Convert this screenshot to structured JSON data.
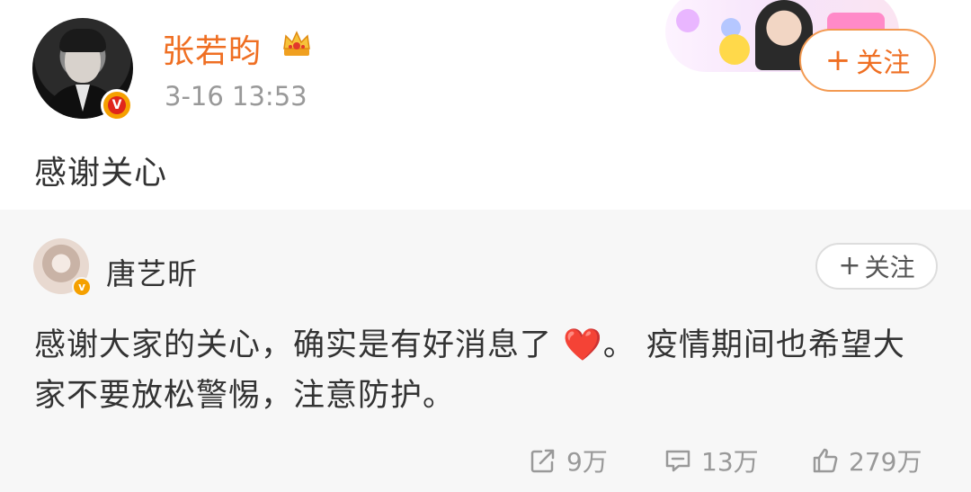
{
  "post": {
    "username": "张若昀",
    "timestamp": "3-16 13:53",
    "follow_label": "关注",
    "text": "感谢关心"
  },
  "quoted": {
    "username": "唐艺昕",
    "follow_label": "关注",
    "text_before_heart": "感谢大家的关心，确实是有好消息了",
    "heart": "❤️",
    "text_after_heart": "。 疫情期间也希望大家不要放松警惕，注意防护。"
  },
  "actions": {
    "reposts": "9万",
    "comments": "13万",
    "likes": "279万"
  },
  "icons": {
    "crown": "crown-icon",
    "verified": "verified-badge-icon",
    "repost": "share-icon",
    "comment": "comment-icon",
    "like": "thumbs-up-icon"
  },
  "colors": {
    "username_accent": "#ef6f23",
    "follow_border": "#f39a52",
    "text": "#333333",
    "meta": "#999999",
    "quoted_bg": "#f7f7f7"
  }
}
